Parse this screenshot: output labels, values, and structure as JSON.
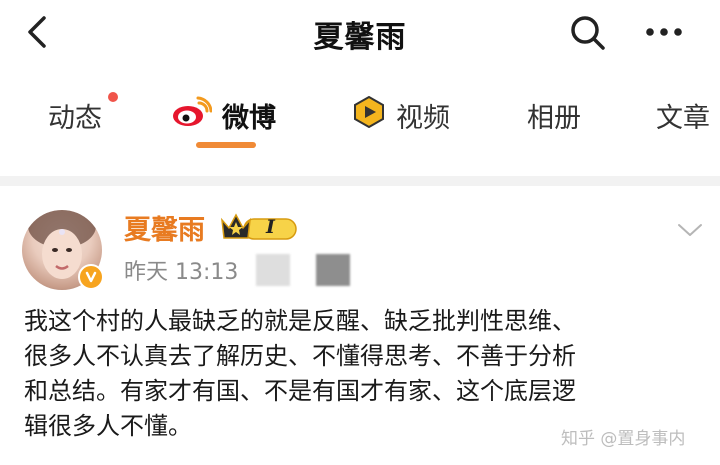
{
  "header": {
    "title": "夏馨雨"
  },
  "tabs": [
    {
      "label": "动态",
      "has_dot": true
    },
    {
      "label": "微博",
      "active": true
    },
    {
      "label": "视频"
    },
    {
      "label": "相册"
    },
    {
      "label": "文章"
    }
  ],
  "post": {
    "author": "夏馨雨",
    "vip_level": "I",
    "time": "昨天 13:13",
    "text_lines": [
      "我这个村的人最缺乏的就是反醒、缺乏批判性思维、",
      "很多人不认真去了解历史、不懂得思考、不善于分析",
      "和总结。有家才有国、不是有国才有家、这个底层逻",
      "辑很多人不懂。"
    ]
  },
  "watermark": "知乎 @置身事内",
  "colors": {
    "accent_orange": "#e87b21",
    "tab_underline": "#f08a36",
    "notify_dot": "#f0544a",
    "vip_gold": "#f2c21b"
  },
  "icons": [
    "back-arrow-icon",
    "search-icon",
    "more-icon",
    "weibo-logo-icon",
    "video-icon",
    "verified-icon",
    "chevron-down-icon",
    "crown-icon"
  ]
}
